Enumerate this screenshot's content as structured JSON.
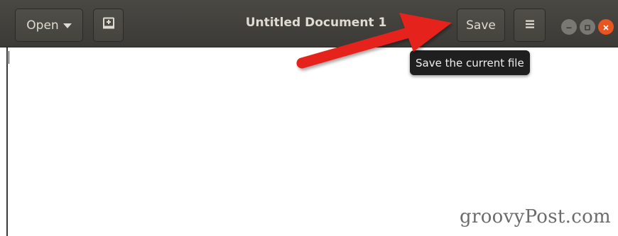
{
  "headerbar": {
    "open_label": "Open",
    "title": "Untitled Document 1",
    "save_label": "Save"
  },
  "tooltip": {
    "text": "Save the current file"
  },
  "watermark": {
    "text": "groovyPost.com"
  },
  "icons": {
    "new_document": "new-document-icon",
    "menu": "hamburger-menu-icon",
    "minimize": "minimize-icon",
    "maximize": "maximize-icon",
    "close": "close-icon"
  },
  "colors": {
    "headerbar": "#3f3d39",
    "close_button": "#e95420",
    "annotation_arrow": "#e5201c",
    "tooltip_bg": "#1f1f1f"
  }
}
